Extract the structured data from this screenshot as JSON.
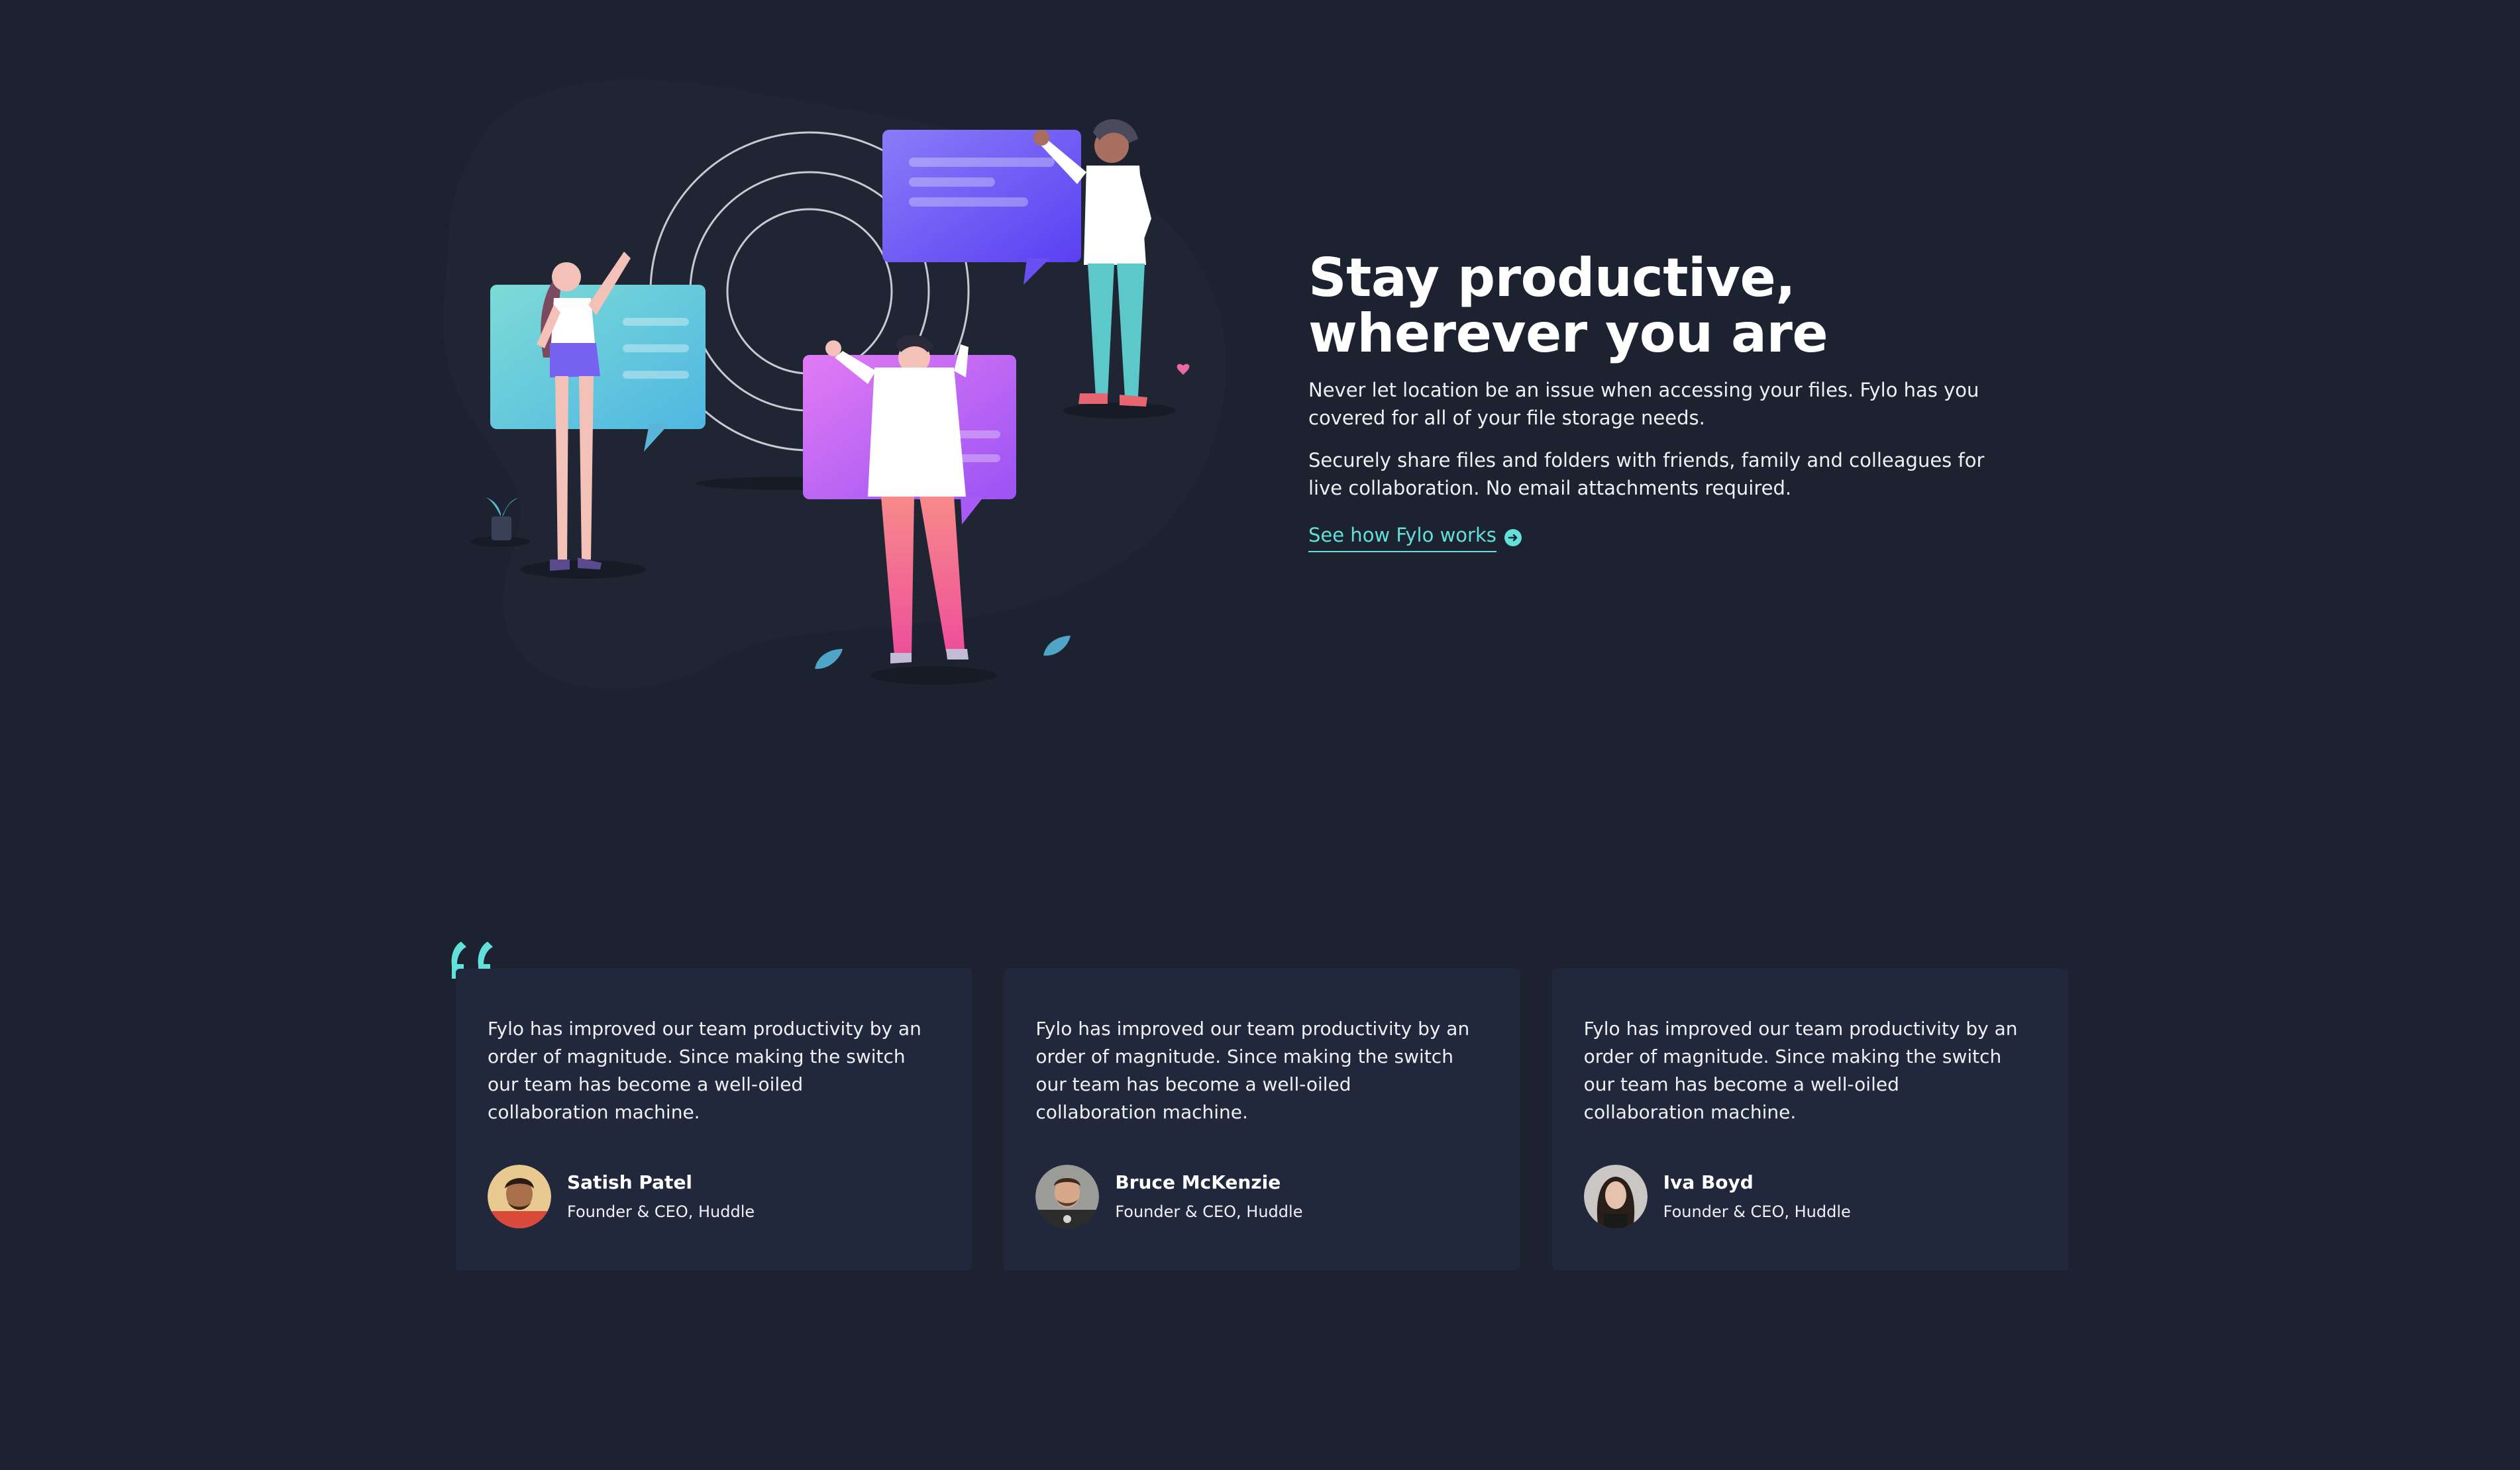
{
  "productive": {
    "heading": "Stay productive, wherever you are",
    "paragraph_1": "Never let location be an issue when accessing your files. Fylo has you covered for all of your file storage needs.",
    "paragraph_2": "Securely share files and folders with friends, family and colleagues for live collaboration. No email attachments required.",
    "cta_label": "See how Fylo works",
    "cta_icon": "arrow-right-circle-icon"
  },
  "colors": {
    "background": "#1c2230",
    "card_background": "#21283b",
    "accent": "#62e0d9",
    "text": "#ffffff"
  },
  "testimonials": [
    {
      "quote": "Fylo has improved our team productivity by an order of magnitude. Since making the switch our team has become a well-oiled collaboration machine.",
      "name": "Satish Patel",
      "role": "Founder & CEO, Huddle"
    },
    {
      "quote": "Fylo has improved our team productivity by an order of magnitude. Since making the switch our team has become a well-oiled collaboration machine.",
      "name": "Bruce McKenzie",
      "role": "Founder & CEO, Huddle"
    },
    {
      "quote": "Fylo has improved our team productivity by an order of magnitude. Since making the switch our team has become a well-oiled collaboration machine.",
      "name": "Iva Boyd",
      "role": "Founder & CEO, Huddle"
    }
  ]
}
